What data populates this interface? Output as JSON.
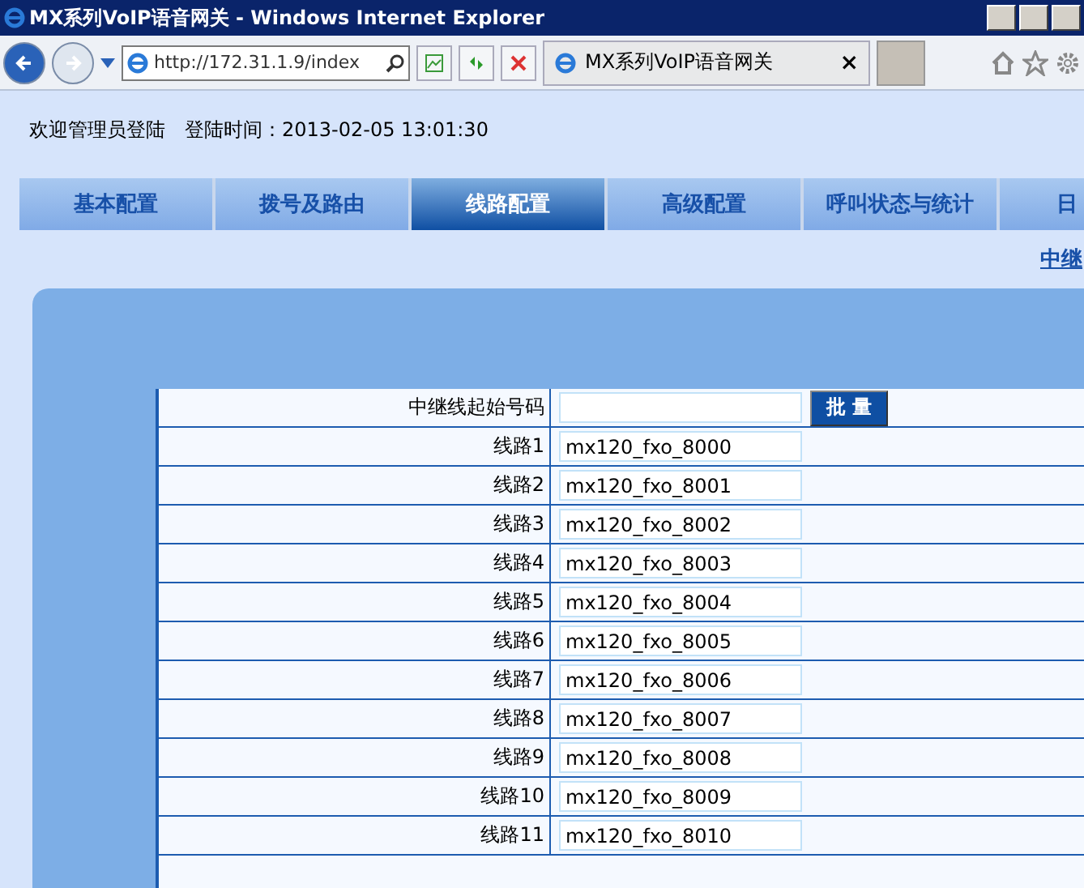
{
  "window": {
    "title": "MX系列VoIP语音网关 - Windows Internet Explorer"
  },
  "browser": {
    "address": "http://172.31.1.9/index",
    "tab_title": "MX系列VoIP语音网关",
    "tab_close": "×"
  },
  "header": {
    "welcome": "欢迎管理员登陆",
    "login_time": "登陆时间：2013-02-05 13:01:30"
  },
  "tabs": [
    {
      "label": "基本配置",
      "selected": false
    },
    {
      "label": "拨号及路由",
      "selected": false
    },
    {
      "label": "线路配置",
      "selected": true
    },
    {
      "label": "高级配置",
      "selected": false
    },
    {
      "label": "呼叫状态与统计",
      "selected": false
    },
    {
      "label": "日",
      "selected": false
    }
  ],
  "sub_link": "中继",
  "form": {
    "start_label": "中继线起始号码",
    "batch_button": "批 量",
    "rows": [
      {
        "label": "线路1",
        "value": "mx120_fxo_8000"
      },
      {
        "label": "线路2",
        "value": "mx120_fxo_8001"
      },
      {
        "label": "线路3",
        "value": "mx120_fxo_8002"
      },
      {
        "label": "线路4",
        "value": "mx120_fxo_8003"
      },
      {
        "label": "线路5",
        "value": "mx120_fxo_8004"
      },
      {
        "label": "线路6",
        "value": "mx120_fxo_8005"
      },
      {
        "label": "线路7",
        "value": "mx120_fxo_8006"
      },
      {
        "label": "线路8",
        "value": "mx120_fxo_8007"
      },
      {
        "label": "线路9",
        "value": "mx120_fxo_8008"
      },
      {
        "label": "线路10",
        "value": "mx120_fxo_8009"
      },
      {
        "label": "线路11",
        "value": "mx120_fxo_8010"
      }
    ]
  }
}
